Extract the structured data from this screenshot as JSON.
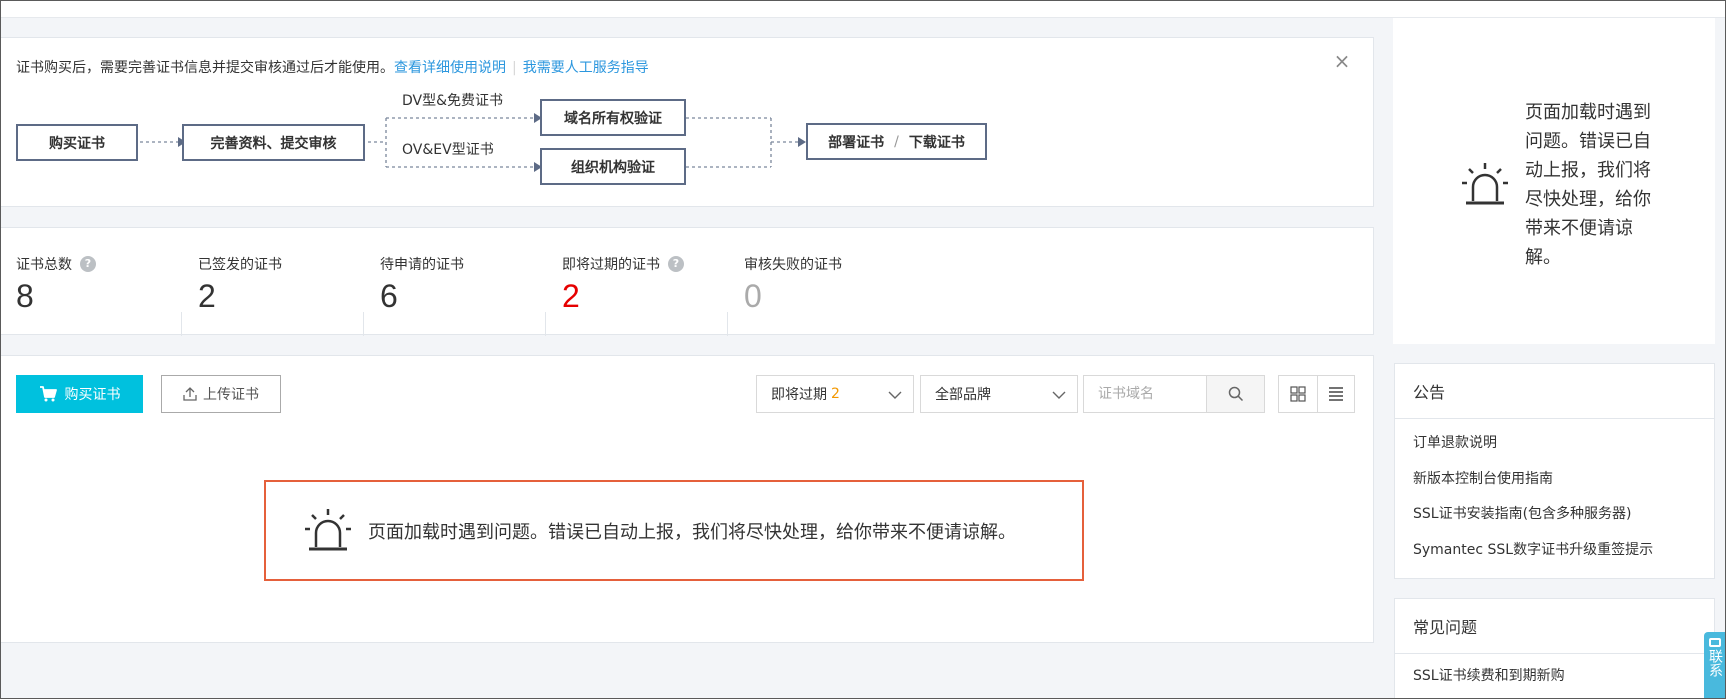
{
  "notice": {
    "text": "证书购买后，需要完善证书信息并提交审核通过后才能使用。",
    "link_detail": "查看详细使用说明",
    "link_service": "我需要人工服务指导",
    "close_label": "×"
  },
  "flow": {
    "step_buy": "购买证书",
    "step_submit": "完善资料、提交审核",
    "branch_dv": "DV型&免费证书",
    "branch_ov": "OV&EV型证书",
    "step_domain_verify": "域名所有权验证",
    "step_org_verify": "组织机构验证",
    "step_deploy": "部署证书",
    "step_separator": "/",
    "step_download": "下载证书"
  },
  "stats": [
    {
      "label": "证书总数",
      "value": "8",
      "has_help": true,
      "help": "?"
    },
    {
      "label": "已签发的证书",
      "value": "2",
      "has_help": false
    },
    {
      "label": "待申请的证书",
      "value": "6",
      "has_help": false
    },
    {
      "label": "即将过期的证书",
      "value": "2",
      "has_help": true,
      "help": "?"
    },
    {
      "label": "审核失败的证书",
      "value": "0",
      "has_help": false
    }
  ],
  "toolbar": {
    "buy_label": "购买证书",
    "upload_label": "上传证书",
    "filter_status": "即将过期",
    "filter_status_count": "2",
    "filter_brand": "全部品牌",
    "search_placeholder": "证书域名"
  },
  "error": {
    "message": "页面加载时遇到问题。错误已自动上报，我们将尽快处理，给你带来不便请谅解。"
  },
  "side_error": {
    "message": "页面加载时遇到问题。错误已自动上报，我们将尽快处理，给你带来不便请谅解。"
  },
  "announcements": {
    "title": "公告",
    "items": [
      "订单退款说明",
      "新版本控制台使用指南",
      "SSL证书安装指南(包含多种服务器)",
      "Symantec SSL数字证书升级重签提示"
    ]
  },
  "faq": {
    "title": "常见问题",
    "items": [
      "SSL证书续费和到期新购"
    ]
  },
  "contact": {
    "label": "联系"
  },
  "colors": {
    "accent": "#00c1de",
    "link": "#2c97de",
    "danger": "#e60000",
    "warning": "#f39800",
    "error_border": "#e5603b",
    "flow_border": "#5d6b86"
  }
}
